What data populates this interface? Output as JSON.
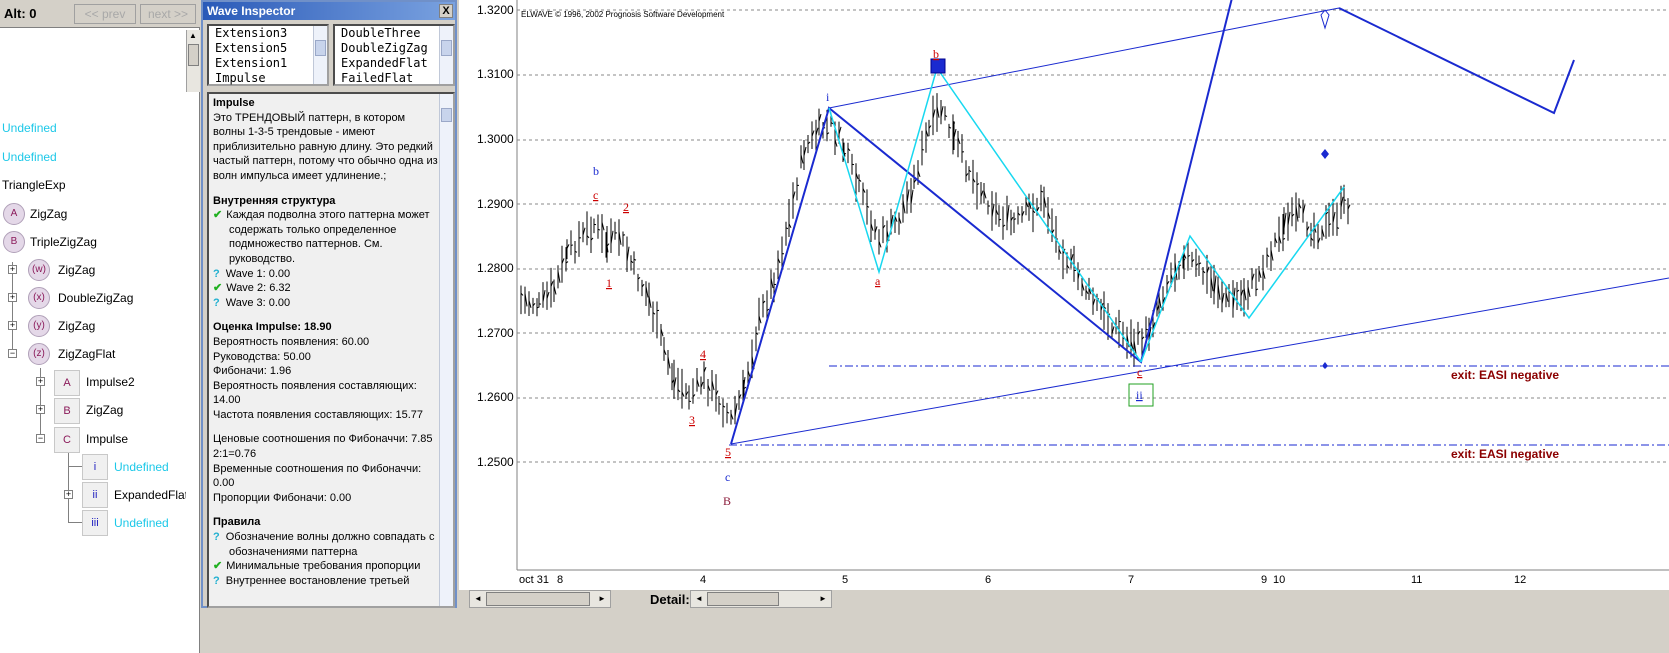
{
  "tree": {
    "alt_label": "Alt: 0",
    "prev_label": "<< prev",
    "next_label": "next >>",
    "nodes": [
      {
        "label": "Undefined",
        "icon": ""
      },
      {
        "label": "Undefined",
        "icon": ""
      },
      {
        "label": "TriangleExp",
        "icon": ""
      },
      {
        "label": "ZigZag",
        "icon": "A"
      },
      {
        "label": "TripleZigZag",
        "icon": "B"
      },
      {
        "label": "ZigZag",
        "icon": "(w)"
      },
      {
        "label": "DoubleZigZag",
        "icon": "(x)"
      },
      {
        "label": "ZigZag",
        "icon": "(y)"
      },
      {
        "label": "ZigZagFlat",
        "icon": "(z)"
      },
      {
        "label": "Impulse2",
        "icon": "A"
      },
      {
        "label": "ZigZag",
        "icon": "B"
      },
      {
        "label": "Impulse",
        "icon": "C"
      },
      {
        "label": "Undefined",
        "icon": "i"
      },
      {
        "label": "ExpandedFlat",
        "icon": "ii"
      },
      {
        "label": "Undefined",
        "icon": "iii"
      }
    ]
  },
  "inspector": {
    "title": "Wave Inspector",
    "close": "X",
    "list_left": [
      "Extension3",
      "Extension5",
      "Extension1",
      "Impulse"
    ],
    "list_right": [
      "DoubleThree",
      "DoubleZigZag",
      "ExpandedFlat",
      "FailedFlat"
    ],
    "pattern_name": "Impulse",
    "description": "Это ТРЕНДОВЫЙ паттерн, в котором волны 1-3-5 трендовые - имеют приблизительно равную длину. Это редкий частый паттерн, потому что обычно одна из волн импульса имеет удлинение.;",
    "structure_header": "Внутренняя структура",
    "structure_items": [
      {
        "mark": "✔",
        "text": "Каждая подволна этого паттерна может содержать только определенное подмножество паттернов. См. руководство."
      },
      {
        "mark": "?",
        "text": "Wave 1: 0.00"
      },
      {
        "mark": "✔",
        "text": "Wave 2: 6.32"
      },
      {
        "mark": "?",
        "text": "Wave 3: 0.00"
      }
    ],
    "score_header": "Оценка Impulse: 18.90",
    "score_lines": [
      "Вероятность появления: 60.00",
      "Руководства: 50.00",
      "Фибоначи: 1.96",
      "Вероятность появления составляющих: 14.00",
      "Частота появления составляющих: 15.77"
    ],
    "fib_lines": [
      "Ценовые соотношения по Фибоначчи: 7.85 2:1=0.76",
      "Временные соотношения по Фибоначчи: 0.00",
      "Пропорции Фибоначи: 0.00"
    ],
    "rules_header": "Правила",
    "rules_items": [
      {
        "mark": "?",
        "text": "Обозначение волны должно совпадать с обозначениями паттерна"
      },
      {
        "mark": "✔",
        "text": "Минимальные требования пропорции"
      },
      {
        "mark": "?",
        "text": "Внутреннее востановление третьей"
      }
    ]
  },
  "chart": {
    "copyright": "ELWAVE © 1996, 2002 Prognosis Software Development",
    "price_labels": [
      "1.3200",
      "1.3100",
      "1.3000",
      "1.2900",
      "1.2800",
      "1.2700",
      "1.2600",
      "1.2500"
    ],
    "date_labels": [
      "oct 31",
      "8",
      "4",
      "5",
      "6",
      "7",
      "9",
      "10",
      "11",
      "12"
    ],
    "exit_label_1": "exit: EASI negative",
    "exit_label_2": "exit: EASI negative",
    "wave_labels": {
      "b_top": "b",
      "c_left": "c",
      "two": "2",
      "one": "1",
      "four": "4",
      "three": "3",
      "five": "5",
      "c_low": "c",
      "B_low": "B",
      "i": "i",
      "b_peak": "b",
      "a": "a",
      "c_mid": "c",
      "ii": "ii"
    },
    "colors": {
      "wave": "#1a2ad0",
      "correction": "#18d8f0",
      "labels": "#cc0000",
      "exit": "#8b0000"
    }
  },
  "bottom": {
    "detail_label": "Detail:"
  }
}
